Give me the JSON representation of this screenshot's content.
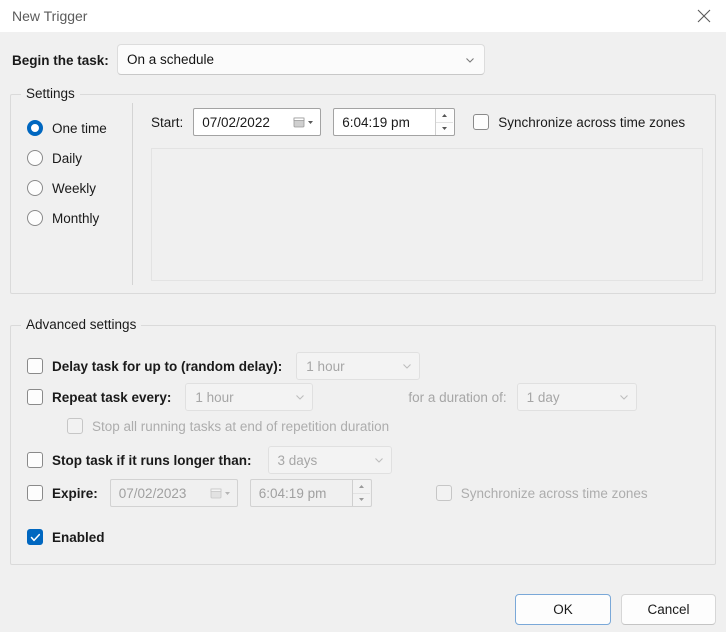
{
  "window": {
    "title": "New Trigger",
    "close_icon": "close-icon"
  },
  "begin": {
    "label": "Begin the task:",
    "value": "On a schedule",
    "chevron_icon": "chevron-down-icon"
  },
  "settings": {
    "legend": "Settings",
    "schedule_options": [
      {
        "label": "One time",
        "checked": true
      },
      {
        "label": "Daily",
        "checked": false
      },
      {
        "label": "Weekly",
        "checked": false
      },
      {
        "label": "Monthly",
        "checked": false
      }
    ],
    "start_label": "Start:",
    "start_date": "07/02/2022",
    "start_time": "6:04:19 pm",
    "calendar_icon": "calendar-icon",
    "sync_label": "Synchronize across time zones",
    "sync_checked": false
  },
  "advanced": {
    "legend": "Advanced settings",
    "delay": {
      "label": "Delay task for up to (random delay):",
      "checked": false,
      "value": "1 hour"
    },
    "repeat": {
      "label": "Repeat task every:",
      "checked": false,
      "value": "1 hour",
      "duration_label": "for a duration of:",
      "duration_value": "1 day"
    },
    "stop_all": {
      "label": "Stop all running tasks at end of repetition duration",
      "checked": false
    },
    "stop_longer": {
      "label": "Stop task if it runs longer than:",
      "checked": false,
      "value": "3 days"
    },
    "expire": {
      "label": "Expire:",
      "checked": false,
      "date": "07/02/2023",
      "time": "6:04:19 pm",
      "sync_label": "Synchronize across time zones",
      "sync_checked": false
    },
    "enabled": {
      "label": "Enabled",
      "checked": true
    }
  },
  "footer": {
    "ok_label": "OK",
    "cancel_label": "Cancel"
  },
  "colors": {
    "accent": "#0067c0",
    "window_bg": "#f0f0f0",
    "titlebar_bg": "#ffffff",
    "disabled_text": "#a6a6a6"
  }
}
